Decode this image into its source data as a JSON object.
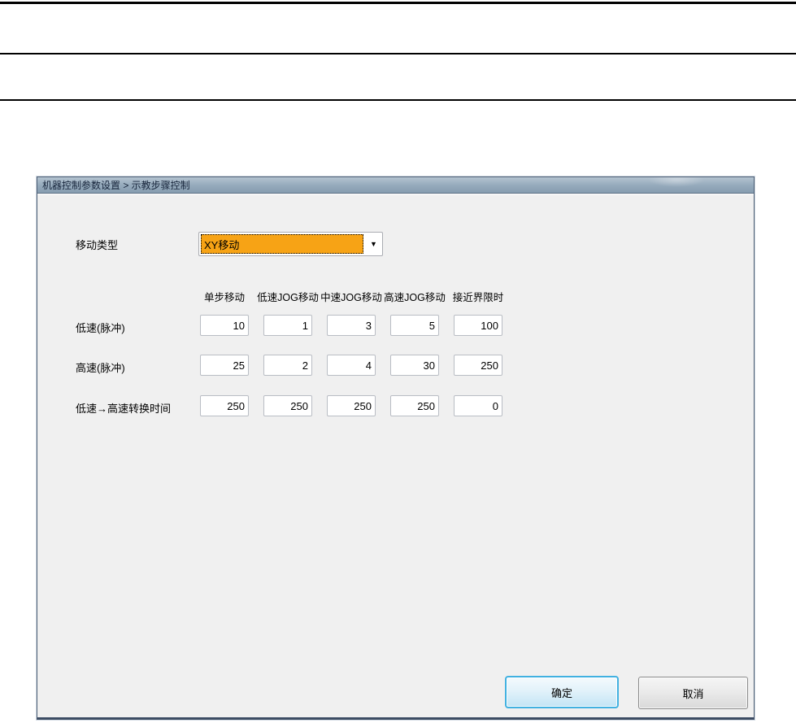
{
  "window": {
    "title": "机器控制参数设置 > 示教步骤控制"
  },
  "form": {
    "move_type": {
      "label": "移动类型",
      "value": "XY移动"
    },
    "table": {
      "column_headers": [
        "单步移动",
        "低速JOG移动",
        "中速JOG移动",
        "高速JOG移动",
        "接近界限时"
      ],
      "rows": [
        {
          "label": "低速(脉冲)",
          "values": [
            "10",
            "1",
            "3",
            "5",
            "100"
          ]
        },
        {
          "label": "高速(脉冲)",
          "values": [
            "25",
            "2",
            "4",
            "30",
            "250"
          ]
        },
        {
          "label": "低速→高速转换时间",
          "values": [
            "250",
            "250",
            "250",
            "250",
            "0"
          ]
        }
      ]
    }
  },
  "buttons": {
    "ok": "确定",
    "cancel": "取消"
  },
  "icons": {
    "dropdown_arrow": "▼"
  },
  "colors": {
    "selection_orange": "#f7a315",
    "titlebar_blue": "#94a9bb",
    "focus_blue": "#41b1e1",
    "dialog_body": "#f0f0f0"
  }
}
